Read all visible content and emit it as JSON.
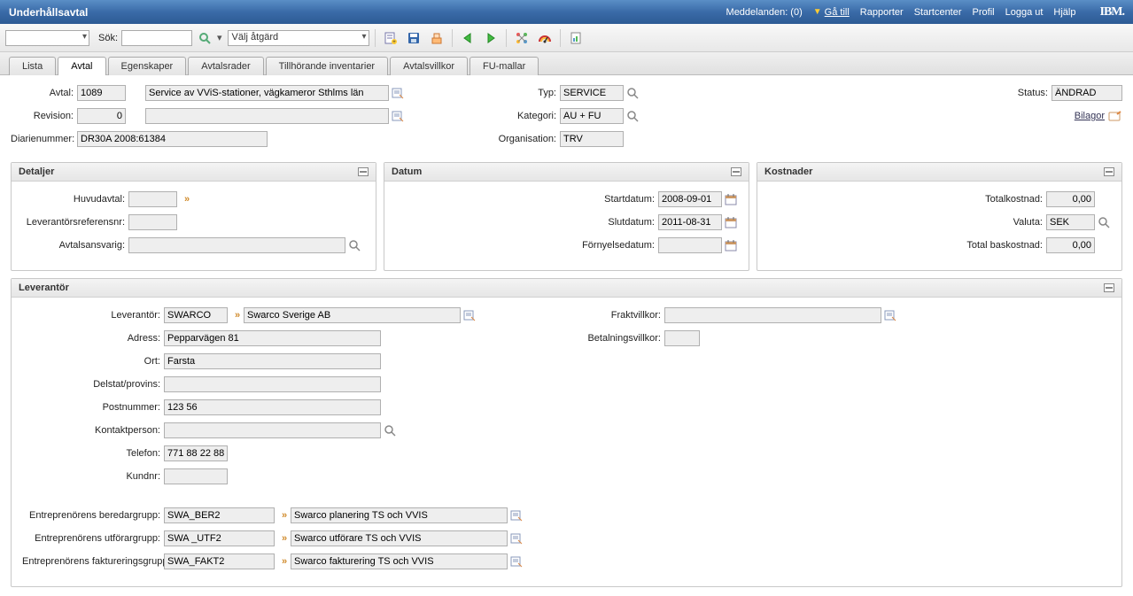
{
  "header": {
    "title": "Underhållsavtal",
    "messages": "Meddelanden: (0)",
    "goto": "Gå till",
    "links": [
      "Rapporter",
      "Startcenter",
      "Profil",
      "Logga ut",
      "Hjälp"
    ],
    "logo": "IBM."
  },
  "toolbar": {
    "search_label": "Sök:",
    "action_label": "Välj åtgärd"
  },
  "tabs": [
    "Lista",
    "Avtal",
    "Egenskaper",
    "Avtalsrader",
    "Tillhörande inventarier",
    "Avtalsvillkor",
    "FU-mallar"
  ],
  "active_tab": 1,
  "top_form": {
    "avtal_label": "Avtal:",
    "avtal": "1089",
    "avtal_desc": "Service av VViS-stationer, vägkameror Sthlms län",
    "revision_label": "Revision:",
    "revision": "0",
    "diarie_label": "Diarienummer:",
    "diarie": "DR30A 2008:61384",
    "typ_label": "Typ:",
    "typ": "SERVICE",
    "kategori_label": "Kategori:",
    "kategori": "AU + FU",
    "org_label": "Organisation:",
    "org": "TRV",
    "status_label": "Status:",
    "status": "ÄNDRAD",
    "bilagor": "Bilagor"
  },
  "panels": {
    "detaljer": {
      "title": "Detaljer",
      "huvudavtal_label": "Huvudavtal:",
      "levref_label": "Leverantörsreferensnr:",
      "ansvarig_label": "Avtalsansvarig:"
    },
    "datum": {
      "title": "Datum",
      "start_label": "Startdatum:",
      "start": "2008-09-01",
      "slut_label": "Slutdatum:",
      "slut": "2011-08-31",
      "forny_label": "Förnyelsedatum:"
    },
    "kostnader": {
      "title": "Kostnader",
      "total_label": "Totalkostnad:",
      "total": "0,00",
      "valuta_label": "Valuta:",
      "valuta": "SEK",
      "bas_label": "Total baskostnad:",
      "bas": "0,00"
    },
    "leverantor": {
      "title": "Leverantör",
      "lev_label": "Leverantör:",
      "lev": "SWARCO",
      "lev_desc": "Swarco Sverige AB",
      "adress_label": "Adress:",
      "adress": "Pepparvägen 81",
      "ort_label": "Ort:",
      "ort": "Farsta",
      "provins_label": "Delstat/provins:",
      "postnr_label": "Postnummer:",
      "postnr": "123 56",
      "kontakt_label": "Kontaktperson:",
      "telefon_label": "Telefon:",
      "telefon": "771 88 22 88",
      "kundnr_label": "Kundnr:",
      "frakt_label": "Fraktvillkor:",
      "betal_label": "Betalningsvillkor:",
      "beredar_label": "Entreprenörens beredargrupp:",
      "beredar": "SWA_BER2",
      "beredar_desc": "Swarco planering TS och VVIS",
      "utfor_label": "Entreprenörens utförargrupp:",
      "utfor": "SWA _UTF2",
      "utfor_desc": "Swarco utförare TS och VVIS",
      "fakt_label": "Entreprenörens faktureringsgrupp:",
      "fakt": "SWA_FAKT2",
      "fakt_desc": "Swarco fakturering TS och VVIS"
    }
  }
}
